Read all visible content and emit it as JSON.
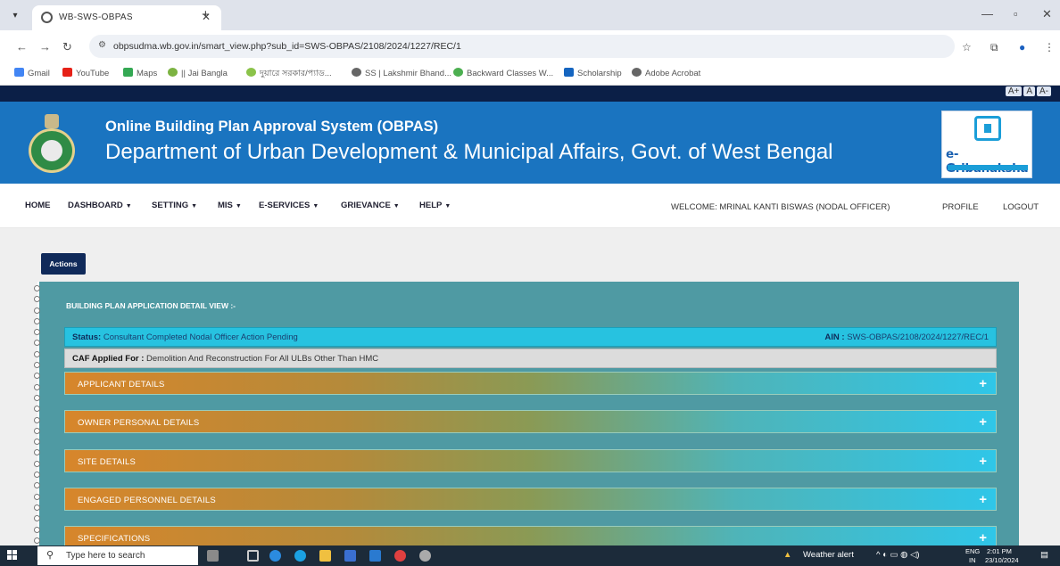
{
  "browser": {
    "tab_title": "WB-SWS-OBPAS",
    "url": "obpsudma.wb.gov.in/smart_view.php?sub_id=SWS-OBPAS/2108/2024/1227/REC/1",
    "bookmarks": [
      "Gmail",
      "YouTube",
      "Maps",
      "|| Jai Bangla",
      "দুয়ারে সরকার/প্যাড...",
      "SS | Lakshmir Bhand...",
      "Backward Classes W...",
      "Scholarship",
      "Adobe Acrobat"
    ]
  },
  "font_controls": [
    "A+",
    "A",
    "A-"
  ],
  "header": {
    "system_title": "Online Building Plan Approval System (OBPAS)",
    "department": "Department of Urban Development & Municipal Affairs, Govt. of West Bengal",
    "logo_text": "e-Gribanaksha"
  },
  "menu": {
    "items": [
      "HOME",
      "DASHBOARD",
      "SETTING",
      "MIS",
      "E-SERVICES",
      "GRIEVANCE",
      "HELP"
    ],
    "welcome": "WELCOME: MRINAL KANTI BISWAS (NODAL OFFICER)",
    "profile": "PROFILE",
    "logout": "LOGOUT"
  },
  "actions_label": "Actions",
  "detail": {
    "title": "BUILDING PLAN APPLICATION DETAIL VIEW :-",
    "status_label": "Status:",
    "status_value": "Consultant Completed Nodal Officer Action Pending",
    "ain_label": "AIN :",
    "ain_value": "SWS-OBPAS/2108/2024/1227/REC/1",
    "caf_label": "CAF Applied For :",
    "caf_value": "Demolition And Reconstruction For All ULBs Other Than HMC",
    "sections": [
      "APPLICANT DETAILS",
      "OWNER PERSONAL DETAILS",
      "SITE DETAILS",
      "ENGAGED PERSONNEL DETAILS",
      "SPECIFICATIONS"
    ]
  },
  "taskbar": {
    "search_placeholder": "Type here to search",
    "weather": "Weather alert",
    "lang_line1": "ENG",
    "lang_line2": "IN",
    "time": "2:01 PM",
    "date": "23/10/2024"
  },
  "colors": {
    "banner_blue": "#1a74c0",
    "nav_dark": "#0b1f47",
    "card_teal": "#4f9aa3",
    "status_cyan": "#27c2e0",
    "section_orange": "#d7862b"
  }
}
